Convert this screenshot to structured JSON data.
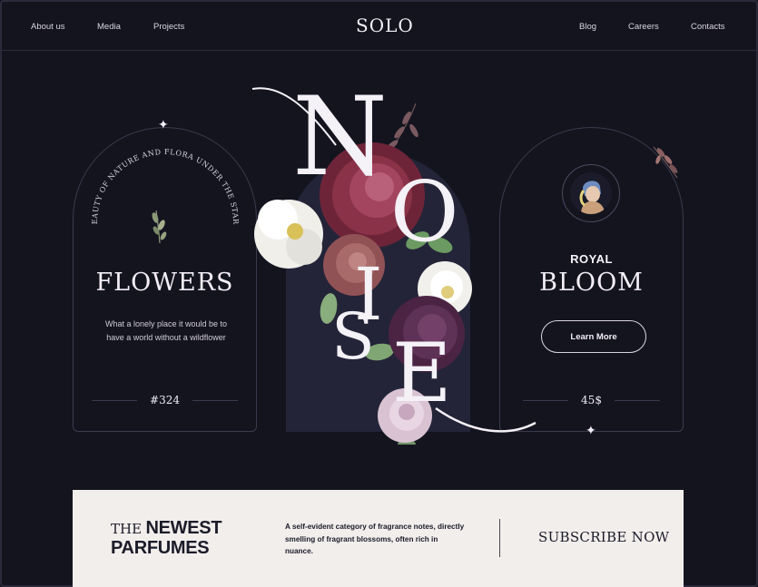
{
  "nav": {
    "left": [
      "About us",
      "Media",
      "Projects"
    ],
    "logo": "SOLO",
    "right": [
      "Blog",
      "Careers",
      "Contacts"
    ]
  },
  "left_card": {
    "curved_text": "BEAUTY OF NATURE AND FLORA UNDER THE STARS",
    "title": "FLOWERS",
    "description": "What a lonely place it would be to have a world without a wildflower",
    "number": "#324"
  },
  "center": {
    "word": "NOISE"
  },
  "right_card": {
    "kicker": "ROYAL",
    "title": "BLOOM",
    "button": "Learn More",
    "price": "45$"
  },
  "banner": {
    "the": "THE",
    "headline_1": "NEWEST",
    "headline_2": "PARFUMES",
    "description": "A self-evident category of fragrance notes, directly smelling of fragrant blossoms, often rich in nuance.",
    "cta": "SUBSCRIBE NOW"
  },
  "colors": {
    "background": "#14141f",
    "arch_fill": "#242438",
    "banner_bg": "#f1eeec",
    "text_light": "#f2eef7",
    "text_dark": "#1c1b29"
  },
  "icons": [
    "sparkle-icon",
    "branch-icon",
    "flower-icon"
  ]
}
